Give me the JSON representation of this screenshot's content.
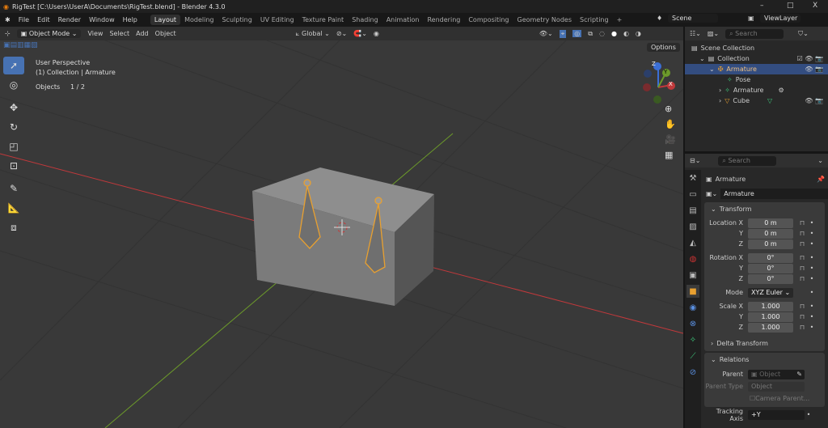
{
  "window": {
    "title": "RigTest [C:\\Users\\UserA\\Documents\\RigTest.blend] - Blender 4.3.0",
    "minimize": "–",
    "maximize": "□",
    "close": "X"
  },
  "menu": [
    "File",
    "Edit",
    "Render",
    "Window",
    "Help"
  ],
  "workspaces": [
    "Layout",
    "Modeling",
    "Sculpting",
    "UV Editing",
    "Texture Paint",
    "Shading",
    "Animation",
    "Rendering",
    "Compositing",
    "Geometry Nodes",
    "Scripting",
    "+"
  ],
  "scene": "Scene",
  "view_layer": "ViewLayer",
  "viewport_header": {
    "mode": "Object Mode",
    "menus": [
      "View",
      "Select",
      "Add",
      "Object"
    ],
    "orientation": "Global",
    "options": "Options"
  },
  "overlay": {
    "perspective": "User Perspective",
    "collection": "(1) Collection | Armature",
    "objects_label": "Objects",
    "objects_value": "1 / 2"
  },
  "gizmo": {
    "x": "X",
    "y": "Y",
    "z": "Z"
  },
  "outliner": {
    "search_placeholder": "Search",
    "items": [
      {
        "label": "Scene Collection",
        "indent": 0
      },
      {
        "label": "Collection",
        "indent": 1
      },
      {
        "label": "Armature",
        "indent": 2,
        "selected": true
      },
      {
        "label": "Pose",
        "indent": 3
      },
      {
        "label": "Armature",
        "indent": 3
      },
      {
        "label": "Cube",
        "indent": 3
      }
    ]
  },
  "properties": {
    "search_placeholder": "Search",
    "object_name": "Armature",
    "name_field": "Armature",
    "transform": {
      "title": "Transform",
      "rows": [
        {
          "label": "Location X",
          "value": "0 m"
        },
        {
          "label": "Y",
          "value": "0 m"
        },
        {
          "label": "Z",
          "value": "0 m"
        },
        {
          "label": "Rotation X",
          "value": "0°"
        },
        {
          "label": "Y",
          "value": "0°"
        },
        {
          "label": "Z",
          "value": "0°"
        }
      ],
      "mode_label": "Mode",
      "mode_value": "XYZ Euler",
      "scale": [
        {
          "label": "Scale X",
          "value": "1.000"
        },
        {
          "label": "Y",
          "value": "1.000"
        },
        {
          "label": "Z",
          "value": "1.000"
        }
      ],
      "delta": "Delta Transform"
    },
    "relations": {
      "title": "Relations",
      "parent_label": "Parent",
      "parent_placeholder": "Object",
      "parent_type_label": "Parent Type",
      "parent_type_value": "Object",
      "camera_parent": "Camera Parent..."
    },
    "tracking_label": "Tracking Axis",
    "tracking_value": "+Y"
  },
  "colors": {
    "accent": "#4772b3",
    "x_axis": "#c0393b",
    "y_axis": "#6c9a2a",
    "selection": "#e8a030"
  }
}
